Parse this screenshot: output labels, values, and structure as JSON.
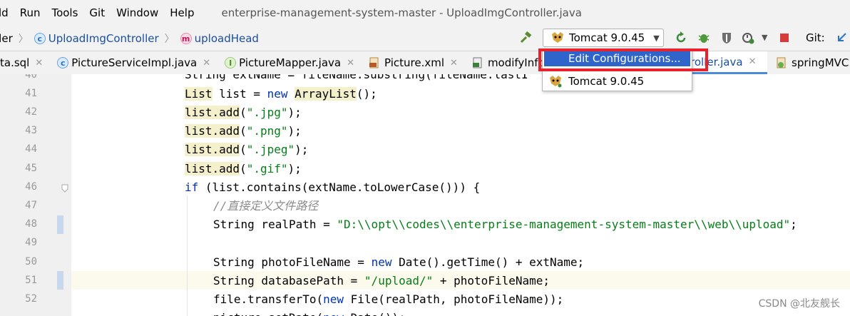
{
  "menubar": {
    "items": [
      "ld",
      "Run",
      "Tools",
      "Git",
      "Window",
      "Help"
    ],
    "window_title": "enterprise-management-system-master - UploadImgController.java"
  },
  "breadcrumb": {
    "partial": "ller",
    "class_name": "UploadImgController",
    "method_name": "uploadHead"
  },
  "toolbar": {
    "run_config_label": "Tomcat 9.0.45",
    "git_label": "Git:"
  },
  "tabs": [
    {
      "label": "ta.sql",
      "icon": "sql-file-icon"
    },
    {
      "label": "PictureServiceImpl.java",
      "icon": "class-icon"
    },
    {
      "label": "PictureMapper.java",
      "icon": "interface-icon"
    },
    {
      "label": "Picture.xml",
      "icon": "xml-file-icon"
    },
    {
      "label": "modifyInfo",
      "icon": "html-file-icon"
    },
    {
      "label": "roller.java",
      "icon": "class-icon"
    },
    {
      "label": "springMVC.",
      "icon": "spring-xml-icon"
    }
  ],
  "popup": {
    "selected_item": "Edit Configurations...",
    "item": "Tomcat 9.0.45"
  },
  "editor": {
    "line_numbers": [
      "40",
      "41",
      "42",
      "43",
      "44",
      "45",
      "46",
      "47",
      "48",
      "49",
      "50",
      "51",
      "52"
    ],
    "line40": "String extName = fileName.substring(fileName.lastI",
    "line48_str": "\"D:\\\\opt\\\\codes\\\\enterprise-management-system-master\\\\web\\\\upload\"",
    "line47_comment": "//直接定义文件路径",
    "line51_str": "\"/upload/\"",
    "str_jpg": "\".jpg\"",
    "str_png": "\".png\"",
    "str_jpeg": "\".jpeg\"",
    "str_gif": "\".gif\""
  },
  "watermark": "CSDN @北友舰长",
  "colors": {
    "keyword": "#0033b3",
    "string": "#067d17",
    "comment": "#8c8c8c",
    "selection": "#2f65ca",
    "highlight_box": "#e8232d"
  }
}
